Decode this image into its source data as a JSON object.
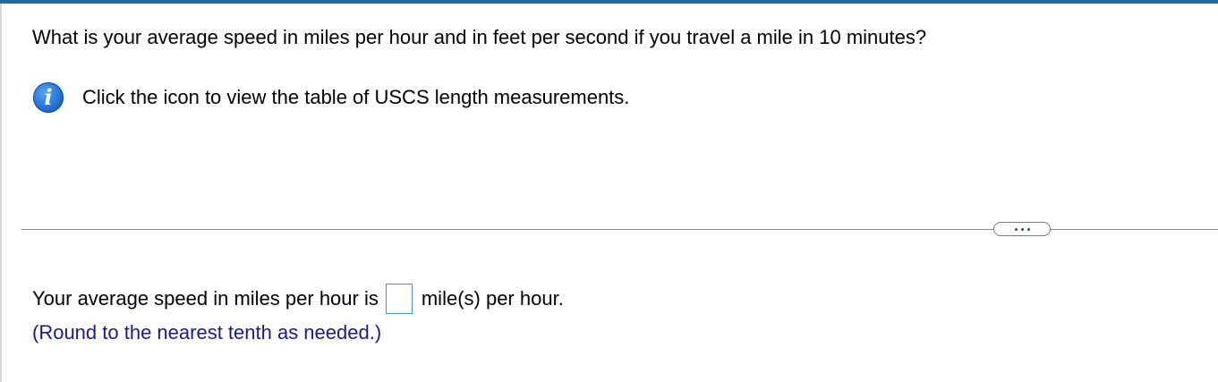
{
  "question": {
    "text": "What is your average speed in miles per hour and in feet per second if you travel a mile in 10 minutes?"
  },
  "info": {
    "icon": "info-icon",
    "text": "Click the icon to view the table of USCS length measurements."
  },
  "more_button": {
    "icon": "ellipsis-icon"
  },
  "answer": {
    "prefix": "Your average speed in miles per hour is",
    "value": "",
    "suffix": "mile(s) per hour.",
    "hint": "(Round to the nearest tenth as needed.)"
  },
  "colors": {
    "accent_bar": "#1d6fa0",
    "hint_text": "#1a1a8c",
    "input_border": "#4a90d9",
    "info_icon": "#1f6fd6"
  }
}
